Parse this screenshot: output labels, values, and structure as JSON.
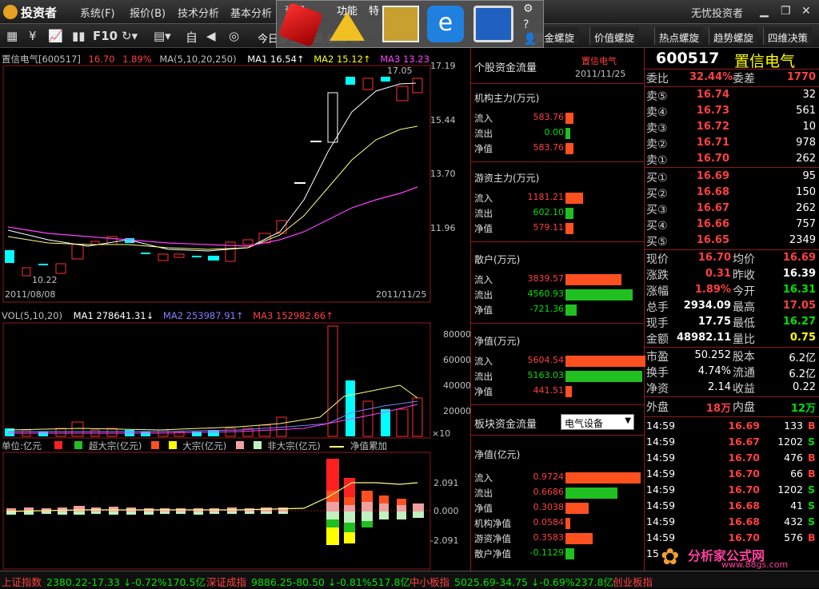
{
  "title_bar": {
    "logo": "投资者",
    "menus": [
      "系统(F)",
      "报价(B)",
      "技术分析",
      "基本分析",
      "",
      "资讯",
      "功能",
      "特"
    ],
    "user": "无忧投资者"
  },
  "toolbar": {
    "f10": "F10",
    "ticker_text": "今日多空 资讯 私募 财"
  },
  "tabs": [
    "资金螺旋",
    "价值螺旋",
    "热点螺旋",
    "趋势螺旋",
    "四维决策"
  ],
  "kline": {
    "header": {
      "name": "置信电气[600517]",
      "price": "16.70",
      "pct": "1.89%",
      "ma_label": "MA(5,10,20,250)",
      "ma1": "MA1 16.54↑",
      "ma2": "MA2 15.12↑",
      "ma3": "MA3 13.23"
    },
    "y_ticks": [
      "17.19",
      "15.44",
      "13.70",
      "11.96"
    ],
    "high_label": "17.05",
    "low_label": "10.22",
    "date_start": "2011/08/08",
    "date_end": "2011/11/25"
  },
  "volume": {
    "header": {
      "label": "VOL(5,10,20)",
      "ma1": "MA1 278641.31↓",
      "ma2": "MA2 253987.91↑",
      "ma3": "MA3 152982.66↑"
    },
    "y_ticks": [
      "80000",
      "60000",
      "40000",
      "20000"
    ],
    "unit": "×10"
  },
  "flow_chart": {
    "legend": {
      "unit": "单位:亿元",
      "super": "超大宗(亿元)",
      "big": "大宗(亿元)",
      "non": "非大宗(亿元)",
      "net": "净值累加"
    },
    "y_ticks": [
      "2.091",
      "0.000",
      "-2.091"
    ]
  },
  "fund_flow": {
    "title": "个股资金流量",
    "stock": "置信电气",
    "date": "2011/11/25",
    "inst": {
      "title": "机构主力(万元)",
      "in": "583.76",
      "out": "0.00",
      "net": "583.76",
      "in_frac": 0.05,
      "out_frac": 0.0,
      "net_frac": 0.05
    },
    "hot": {
      "title": "游资主力(万元)",
      "in": "1181.21",
      "out": "602.10",
      "net": "579.11",
      "in_frac": 0.11,
      "out_frac": 0.05,
      "net_frac": 0.05
    },
    "retail": {
      "title": "散户(万元)",
      "in": "3839.57",
      "out": "4560.93",
      "net": "-721.36",
      "in_frac": 0.35,
      "out_frac": 0.42,
      "net_frac": 0.07
    },
    "total": {
      "title": "净值(万元)",
      "in": "5604.54",
      "out": "5163.03",
      "net": "441.51",
      "in_frac": 0.52,
      "out_frac": 0.48,
      "net_frac": 0.04
    },
    "sector": {
      "title": "板块资金流量",
      "select": "电气设备"
    },
    "sector_net": {
      "title": "净值(亿元)",
      "rows": [
        {
          "label": "流入",
          "val": "0.9724",
          "frac": 0.52,
          "color": "#ff5020"
        },
        {
          "label": "流出",
          "val": "0.6686",
          "frac": 0.36,
          "color": "#20c020"
        },
        {
          "label": "净值",
          "val": "0.3038",
          "frac": 0.16,
          "color": "#ff5020"
        },
        {
          "label": "机构净值",
          "val": "0.0584",
          "frac": 0.03,
          "color": "#ff5020"
        },
        {
          "label": "游资净值",
          "val": "0.3583",
          "frac": 0.19,
          "color": "#ff5020"
        },
        {
          "label": "散户净值",
          "val": "-0.1129",
          "frac": 0.06,
          "color": "#20c020"
        }
      ]
    },
    "labels": {
      "in": "流入",
      "out": "流出",
      "net": "净值"
    }
  },
  "quote": {
    "code": "600517",
    "name": "置信电气",
    "weibi_label": "委比",
    "weibi": "32.44%",
    "weicha_label": "委差",
    "weicha": "1770",
    "sells": [
      {
        "label": "卖⑤",
        "price": "16.74",
        "vol": "32"
      },
      {
        "label": "卖④",
        "price": "16.73",
        "vol": "561"
      },
      {
        "label": "卖③",
        "price": "16.72",
        "vol": "10"
      },
      {
        "label": "卖②",
        "price": "16.71",
        "vol": "978"
      },
      {
        "label": "卖①",
        "price": "16.70",
        "vol": "262"
      }
    ],
    "buys": [
      {
        "label": "买①",
        "price": "16.69",
        "vol": "95"
      },
      {
        "label": "买②",
        "price": "16.68",
        "vol": "150"
      },
      {
        "label": "买③",
        "price": "16.67",
        "vol": "262"
      },
      {
        "label": "买④",
        "price": "16.66",
        "vol": "757"
      },
      {
        "label": "买⑤",
        "price": "16.65",
        "vol": "2349"
      }
    ],
    "stats": [
      {
        "l1": "现价",
        "v1": "16.70",
        "c1": "red",
        "l2": "均价",
        "v2": "16.69",
        "c2": "red"
      },
      {
        "l1": "涨跌",
        "v1": "0.31",
        "c1": "red",
        "l2": "昨收",
        "v2": "16.39",
        "c2": "white"
      },
      {
        "l1": "涨幅",
        "v1": "1.89%",
        "c1": "red",
        "l2": "今开",
        "v2": "16.31",
        "c2": "green"
      },
      {
        "l1": "总手",
        "v1": "2934.09",
        "c1": "white",
        "l2": "最高",
        "v2": "17.05",
        "c2": "red"
      },
      {
        "l1": "现手",
        "v1": "17.75",
        "c1": "white",
        "l2": "最低",
        "v2": "16.27",
        "c2": "green"
      },
      {
        "l1": "金额",
        "v1": "48982.11",
        "c1": "white",
        "l2": "量比",
        "v2": "0.75",
        "c2": "yellow"
      }
    ],
    "stats2": [
      {
        "l1": "市盈",
        "v1": "50.252",
        "l2": "股本",
        "v2": "6.2亿"
      },
      {
        "l1": "换手",
        "v1": "4.74%",
        "l2": "流通",
        "v2": "6.2亿"
      },
      {
        "l1": "净资",
        "v1": "2.14",
        "l2": "收益",
        "v2": "0.22"
      }
    ],
    "outer_label": "外盘",
    "outer": "18万",
    "inner_label": "内盘",
    "inner": "12万",
    "ticks": [
      {
        "t": "14:59",
        "p": "16.69",
        "v": "133",
        "s": "B"
      },
      {
        "t": "14:59",
        "p": "16.67",
        "v": "1202",
        "s": "S"
      },
      {
        "t": "14:59",
        "p": "16.70",
        "v": "476",
        "s": "B"
      },
      {
        "t": "14:59",
        "p": "16.70",
        "v": "66",
        "s": "B"
      },
      {
        "t": "14:59",
        "p": "16.70",
        "v": "1202",
        "s": "S"
      },
      {
        "t": "14:59",
        "p": "16.68",
        "v": "41",
        "s": "S"
      },
      {
        "t": "14:59",
        "p": "16.68",
        "v": "432",
        "s": "S"
      },
      {
        "t": "14:59",
        "p": "16.70",
        "v": "576",
        "s": "B"
      }
    ],
    "last_tick_time": "15"
  },
  "watermark": {
    "name": "分析家公式网",
    "url": "www.88gs.com"
  },
  "status": [
    {
      "name": "上证指数",
      "val": "2380.22-17.33 ↓-0.72%170.5亿"
    },
    {
      "name": "深证成指",
      "val": "9886.25-80.50 ↓-0.81%517.8亿"
    },
    {
      "name": "中小板指",
      "val": "5025.69-34.75 ↓-0.69%237.8亿"
    },
    {
      "name": "创业板指",
      "val": ""
    }
  ],
  "colors": {
    "up": "#ff3030",
    "down": "#00ffff",
    "ma1": "#ffffff",
    "ma2": "#ffff80",
    "ma3": "#ff40ff",
    "flow_up": "#ff5020",
    "flow_down": "#20c020"
  }
}
